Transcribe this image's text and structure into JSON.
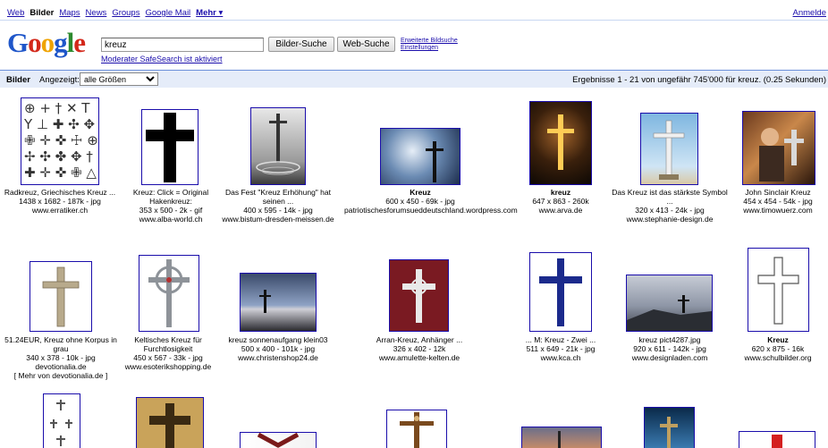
{
  "nav": {
    "items": [
      "Web",
      "Bilder",
      "Maps",
      "News",
      "Groups",
      "Google Mail",
      "Mehr ▾"
    ],
    "current": "Bilder",
    "signin": "Anmelde"
  },
  "header": {
    "logo": "Google",
    "query": "kreuz",
    "btn_images": "Bilder-Suche",
    "btn_web": "Web-Suche",
    "adv_search": "Erweiterte Bildsuche",
    "settings": "Einstellungen",
    "safesearch": "Moderater SafeSearch ist aktiviert"
  },
  "bar": {
    "label": "Bilder",
    "shown": "Angezeigt:",
    "size_value": "alle Größen",
    "stats": "Ergebnisse 1 - 21 von ungefähr 745'000 für kreuz. (0.25 Sekunden)"
  },
  "results": [
    {
      "title": "Radkreuz, Griechisches Kreuz ...",
      "meta": "1438 x 1682 - 187k - jpg",
      "domain": "www.erratiker.ch"
    },
    {
      "title": "Kreuz: Click = Original Hakenkreuz:",
      "meta": "353 x 500 - 2k - gif",
      "domain": "www.alba-world.ch"
    },
    {
      "title": "Das Fest \"Kreuz Erhöhung\" hat seinen ...",
      "meta": "400 x 595 - 14k - jpg",
      "domain": "www.bistum-dresden-meissen.de"
    },
    {
      "title": "Kreuz",
      "meta": "600 x 450 - 69k - jpg",
      "domain": "patriotischesforumsueddeutschland.wordpress.com"
    },
    {
      "title": "kreuz",
      "meta": "647 x 863 - 260k",
      "domain": "www.arva.de"
    },
    {
      "title": "Das Kreuz ist das stärkste Symbol ...",
      "meta": "320 x 413 - 24k - jpg",
      "domain": "www.stephanie-design.de"
    },
    {
      "title": "John Sinclair Kreuz",
      "meta": "454 x 454 - 54k - jpg",
      "domain": "www.timowuerz.com"
    },
    {
      "title": "51.24EUR, Kreuz ohne Korpus in grau",
      "meta": "340 x 378 - 10k - jpg",
      "domain": "devotionalia.de",
      "more": "[ Mehr von devotionalia.de ]"
    },
    {
      "title": "Keltisches Kreuz für Furchtlosigkeit",
      "meta": "450 x 567 - 33k - jpg",
      "domain": "www.esoterikshopping.de"
    },
    {
      "title": "kreuz sonnenaufgang klein03",
      "meta": "500 x 400 - 101k - jpg",
      "domain": "www.christenshop24.de"
    },
    {
      "title": "Arran-Kreuz, Anhänger ...",
      "meta": "326 x 402 - 12k",
      "domain": "www.amulette-kelten.de"
    },
    {
      "title": "... M: Kreuz - Zwei ...",
      "meta": "511 x 649 - 21k - jpg",
      "domain": "www.kca.ch"
    },
    {
      "title": "kreuz pict4287.jpg",
      "meta": "920 x 611 - 142k - jpg",
      "domain": "www.designladen.com"
    },
    {
      "title": "Kreuz",
      "meta": "620 x 875 - 16k",
      "domain": "www.schulbilder.org"
    }
  ]
}
